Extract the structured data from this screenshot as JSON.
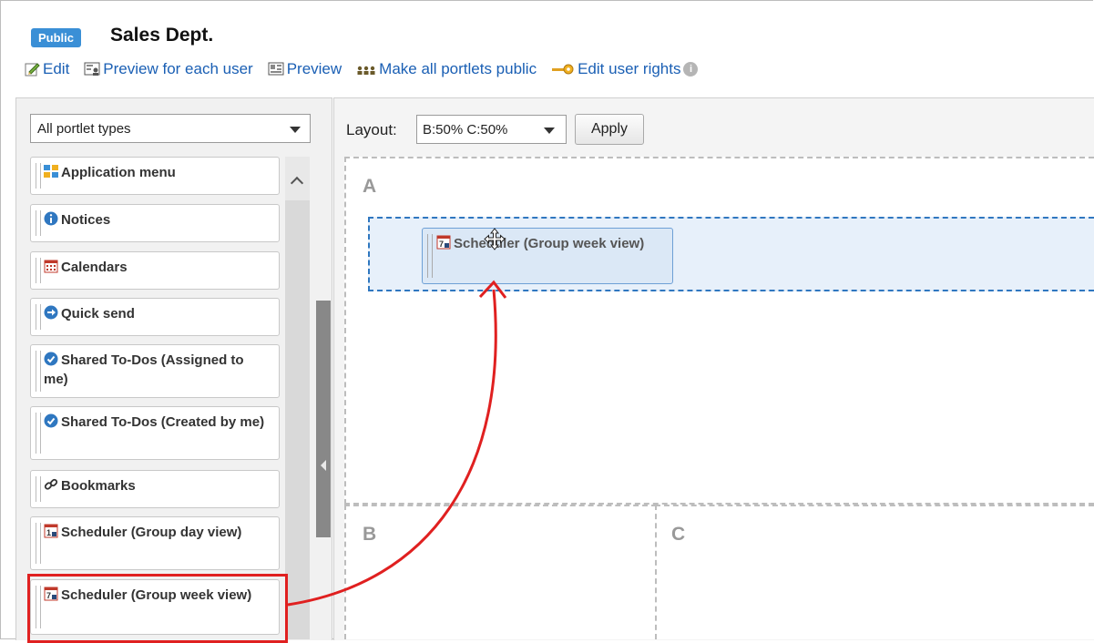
{
  "header": {
    "badge": "Public",
    "title": "Sales Dept."
  },
  "toolbar": {
    "edit": "Edit",
    "preview_each": "Preview for each user",
    "preview": "Preview",
    "make_public": "Make all portlets public",
    "edit_rights": "Edit user rights",
    "info": "i"
  },
  "sidebar": {
    "filter_value": "All portlet types",
    "items": [
      {
        "label": "Application menu",
        "icon": "app-menu-icon"
      },
      {
        "label": "Notices",
        "icon": "info-icon"
      },
      {
        "label": "Calendars",
        "icon": "calendar-icon"
      },
      {
        "label": "Quick send",
        "icon": "quick-send-icon"
      },
      {
        "label": "Shared To-Dos (Assigned to me)",
        "icon": "todo-icon"
      },
      {
        "label": "Shared To-Dos (Created by me)",
        "icon": "todo-icon"
      },
      {
        "label": "Bookmarks",
        "icon": "link-icon"
      },
      {
        "label": "Scheduler (Group day view)",
        "icon": "scheduler-day-icon"
      },
      {
        "label": "Scheduler (Group week view)",
        "icon": "scheduler-week-icon"
      }
    ]
  },
  "layout": {
    "label": "Layout:",
    "value": "B:50% C:50%",
    "apply": "Apply"
  },
  "zones": {
    "a": "A",
    "b": "B",
    "c": "C"
  },
  "dragging": {
    "label": "Scheduler (Group week view)"
  },
  "colors": {
    "link": "#1a5fb4",
    "badge": "#3a8fd6",
    "dropzone_border": "#2f77c0",
    "annotation": "#e02020"
  }
}
